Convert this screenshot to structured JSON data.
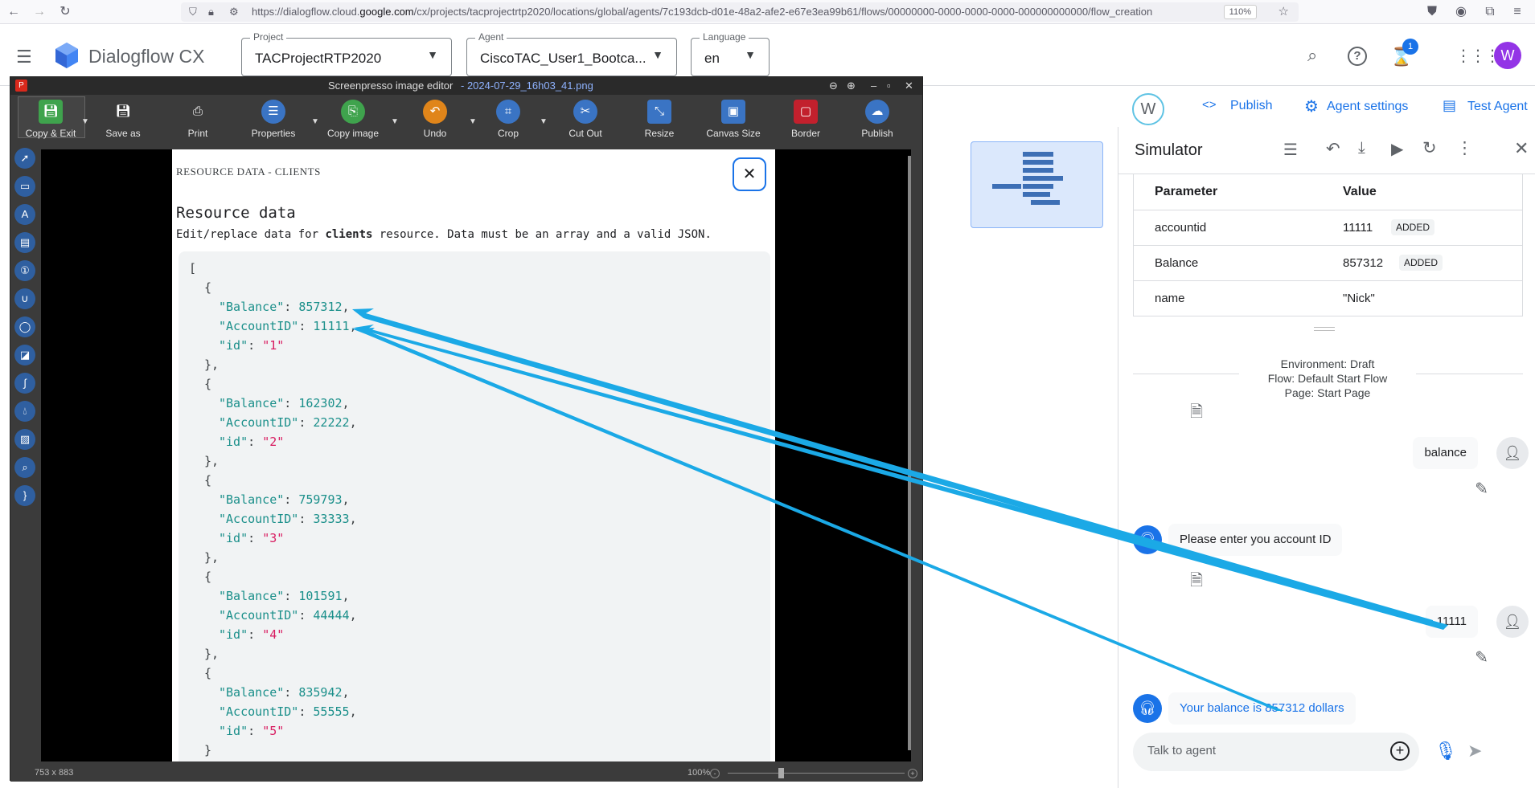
{
  "browser": {
    "url_prefix": "https://dialogflow.cloud.",
    "url_domain": "google.com",
    "url_rest": "/cx/projects/tacprojectrtp2020/locations/global/agents/7c193dcb-d01e-48a2-afe2-e67e3ea99b61/flows/00000000-0000-0000-0000-000000000000/flow_creation",
    "zoom": "110%"
  },
  "header": {
    "app_name": "Dialogflow CX",
    "project_label": "Project",
    "project_value": "TACProjectRTP2020",
    "agent_label": "Agent",
    "agent_value": "CiscoTAC_User1_Bootca...",
    "language_label": "Language",
    "language_value": "en",
    "notif_count": "1",
    "user_initial": "W"
  },
  "subbar": {
    "user_initial": "W",
    "publish": "Publish",
    "agent_settings": "Agent settings",
    "test_agent": "Test Agent"
  },
  "simulator": {
    "title": "Simulator",
    "param_header": "Parameter",
    "value_header": "Value",
    "params": [
      {
        "name": "accountid",
        "value": "11111",
        "badge": "ADDED"
      },
      {
        "name": "Balance",
        "value": "857312",
        "badge": "ADDED"
      },
      {
        "name": "name",
        "value": "\"Nick\"",
        "badge": ""
      }
    ],
    "env_line1": "Environment: Draft",
    "env_line2": "Flow: Default Start Flow",
    "env_line3": "Page: Start Page",
    "msg_user1": "balance",
    "msg_bot1": "Please enter you account ID",
    "msg_user2": "11111",
    "msg_bot2": "Your balance is 857312 dollars",
    "input_placeholder": "Talk to agent"
  },
  "screenpresso": {
    "title": "Screenpresso image editor",
    "filename": "-  2024-07-29_16h03_41.png",
    "tools": [
      "Copy & Exit",
      "Save as",
      "Print",
      "Properties",
      "Copy image",
      "Undo",
      "Crop",
      "Cut Out",
      "Resize",
      "Canvas Size",
      "Border",
      "Publish"
    ],
    "size": "753 x 883",
    "zoom": "100%"
  },
  "doc": {
    "section": "RESOURCE DATA - CLIENTS",
    "heading": "Resource data",
    "desc_pre": "Edit/replace data for ",
    "desc_bold": "clients",
    "desc_post": " resource. Data must be an array and a valid JSON.",
    "records": [
      {
        "balance": "857312",
        "account": "11111",
        "id": "\"1\""
      },
      {
        "balance": "162302",
        "account": "22222",
        "id": "\"2\""
      },
      {
        "balance": "759793",
        "account": "33333",
        "id": "\"3\""
      },
      {
        "balance": "101591",
        "account": "44444",
        "id": "\"4\""
      },
      {
        "balance": "835942",
        "account": "55555",
        "id": "\"5\""
      }
    ],
    "key_balance": "\"Balance\"",
    "key_account": "\"AccountID\"",
    "key_id": "\"id\""
  },
  "colors": {
    "accent": "#1a73e8",
    "arrow": "#1ba9e6"
  }
}
